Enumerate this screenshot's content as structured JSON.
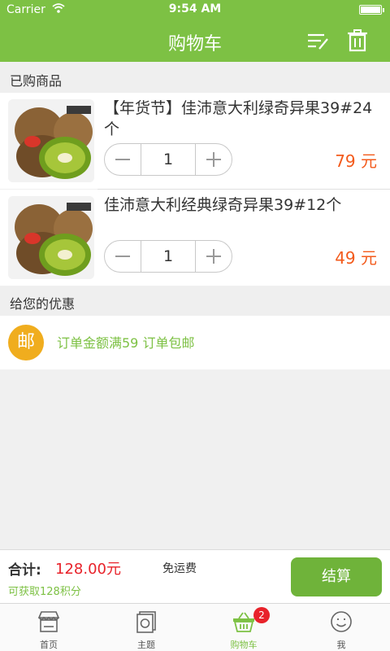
{
  "status_bar": {
    "carrier": "Carrier",
    "time": "9:54 AM"
  },
  "nav": {
    "title": "购物车",
    "edit_icon": "edit-list-icon",
    "trash_icon": "trash-icon"
  },
  "colors": {
    "brand_green": "#7dc144",
    "price_orange": "#f35a1b",
    "total_red": "#e8222a",
    "badge_gold": "#f0ad1e"
  },
  "purchased": {
    "header": "已购商品",
    "items": [
      {
        "name": "【年货节】佳沛意大利绿奇异果39#24个",
        "qty": "1",
        "price": "79 元",
        "image": "kiwi-fruit-image"
      },
      {
        "name": "佳沛意大利经典绿奇异果39#12个",
        "qty": "1",
        "price": "49 元",
        "image": "kiwi-fruit-image"
      }
    ]
  },
  "offers": {
    "header": "给您的优惠",
    "badge": "邮",
    "text": "订单金额满59 订单包邮"
  },
  "checkout": {
    "total_label": "合计:",
    "total_value": "128.00元",
    "shipping": "免运费",
    "points": "可获取128积分",
    "button": "结算"
  },
  "tabbar": {
    "tabs": [
      {
        "label": "首页",
        "icon": "store-icon"
      },
      {
        "label": "主题",
        "icon": "theme-icon"
      },
      {
        "label": "购物车",
        "icon": "basket-icon",
        "badge": "2"
      },
      {
        "label": "我",
        "icon": "smiley-icon"
      }
    ]
  }
}
